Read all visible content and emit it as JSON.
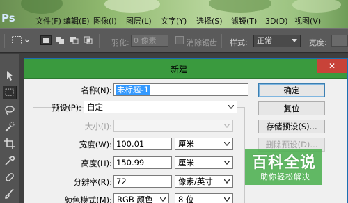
{
  "app": {
    "logo": "Ps"
  },
  "menu": [
    {
      "label": "文件(F)"
    },
    {
      "label": "编辑(E)"
    },
    {
      "label": "图像(I)"
    },
    {
      "label": "图层(L)"
    },
    {
      "label": "文字(Y)"
    },
    {
      "label": "选择(S)"
    },
    {
      "label": "滤镜(T)"
    },
    {
      "label": "3D(D)"
    },
    {
      "label": "视图(V)"
    }
  ],
  "options_bar": {
    "feather_label": "羽化:",
    "feather_value": "0 像素",
    "antialias_label": "消除锯齿",
    "style_label": "样式:",
    "style_value": "正常",
    "width_label": "宽度:"
  },
  "dialog": {
    "title": "新建",
    "close_symbol": "✕",
    "name_label": "名称(N):",
    "name_value": "未标题-1",
    "preset_label": "预设(P):",
    "preset_value": "自定",
    "size_label": "大小(I):",
    "size_value": "",
    "width_label": "宽度(W):",
    "width_value": "100.01",
    "width_unit": "厘米",
    "height_label": "高度(H):",
    "height_value": "150.99",
    "height_unit": "厘米",
    "resolution_label": "分辨率(R):",
    "resolution_value": "72",
    "resolution_unit": "像素/英寸",
    "color_mode_label": "颜色模式(M):",
    "color_mode_value": "RGB 颜色",
    "bit_depth_value": "8 位",
    "buttons": {
      "ok": "确定",
      "reset": "复位",
      "save_preset": "存储预设(S)...",
      "delete_preset": "删除预设(D)..."
    }
  },
  "watermark": {
    "main": "百科全说",
    "sub": "助你轻松解决",
    "color": "#4caf50"
  },
  "colors": {
    "dialog_title_bg": "#3a9a3e",
    "close_button_bg": "#c84339",
    "selection_highlight": "#3399ff"
  }
}
